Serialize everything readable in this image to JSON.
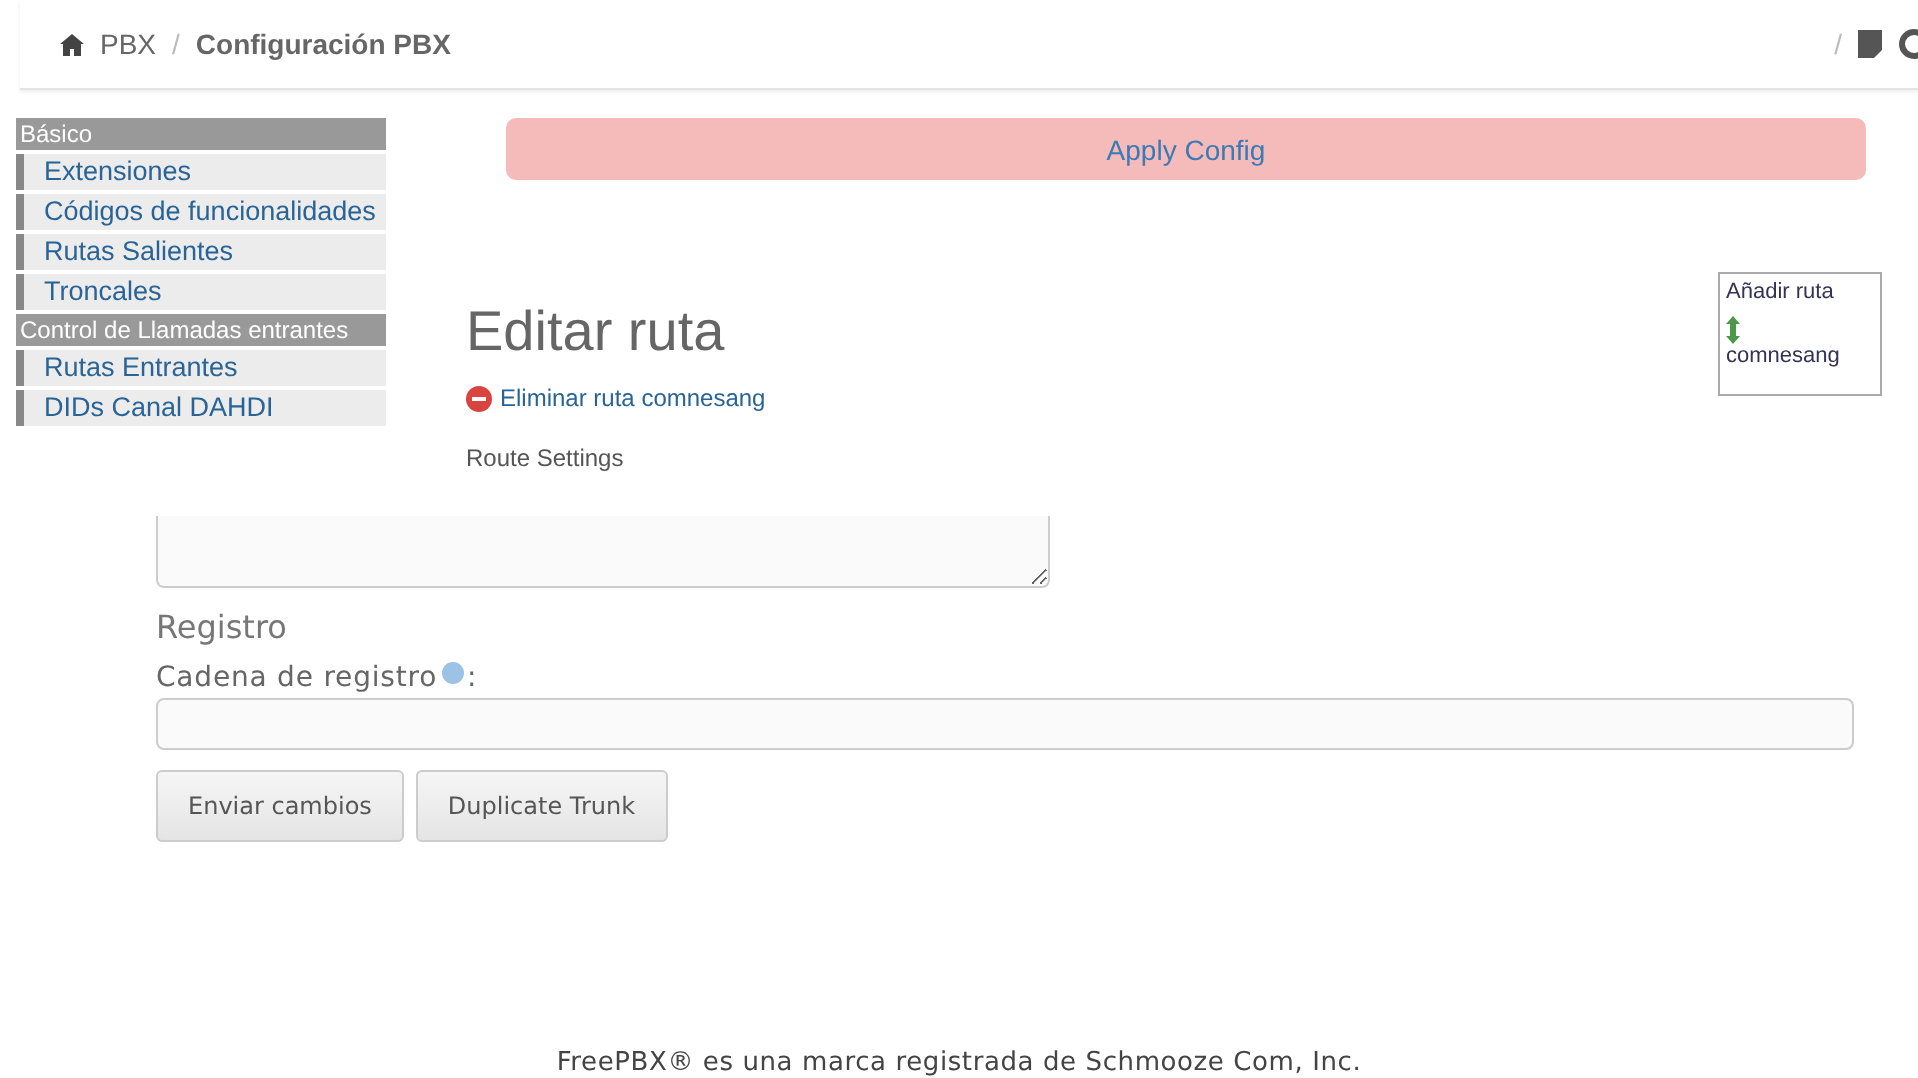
{
  "breadcrumb": {
    "items": [
      "PBX",
      "Configuración PBX"
    ],
    "separator": "/"
  },
  "header_right": {
    "separator": "/"
  },
  "sidebar": {
    "sections": [
      {
        "title": "Básico",
        "items": [
          "Extensiones",
          "Códigos de funcionalidades",
          "Rutas Salientes",
          "Troncales"
        ]
      },
      {
        "title": "Control de Llamadas entrantes",
        "items": [
          "Rutas Entrantes",
          "DIDs Canal DAHDI"
        ]
      }
    ]
  },
  "apply_config": "Apply Config",
  "page_title": "Editar ruta",
  "delete_link": "Eliminar ruta comnesang",
  "section_label": "Route Settings",
  "route_list": {
    "add_label": "Añadir ruta",
    "routes": [
      "comnesang"
    ]
  },
  "registro": {
    "heading": "Registro",
    "label": "Cadena de registro",
    "colon": ":"
  },
  "buttons": [
    "Enviar cambios",
    "Duplicate Trunk"
  ],
  "footer": "FreePBX® es una marca registrada de Schmooze Com, Inc."
}
